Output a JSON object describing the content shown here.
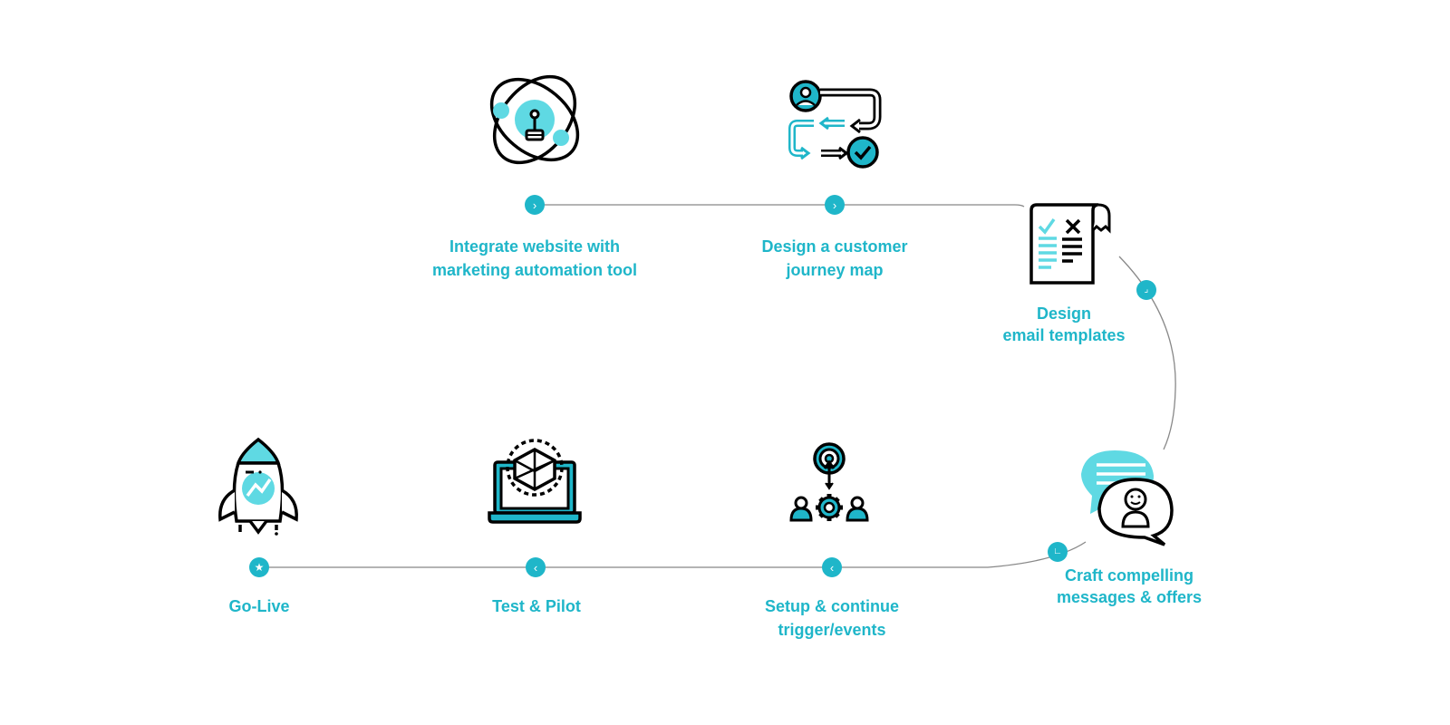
{
  "colors": {
    "accent": "#1fb6c9",
    "icon_fill": "#5fd9e3",
    "stroke": "#000000",
    "line": "#888888"
  },
  "steps": [
    {
      "id": "integrate",
      "lines": [
        "Integrate website with",
        "marketing automation tool"
      ],
      "icon": "atom-lightbulb-icon",
      "marker": "chevron-right-icon",
      "marker_glyph": "›"
    },
    {
      "id": "journey",
      "lines": [
        "Design a customer",
        "journey map"
      ],
      "icon": "customer-journey-flow-icon",
      "marker": "chevron-right-icon",
      "marker_glyph": "›"
    },
    {
      "id": "email",
      "lines": [
        "Design",
        "email templates"
      ],
      "icon": "email-template-document-icon",
      "marker": "chevron-down-icon",
      "marker_glyph": "⌟"
    },
    {
      "id": "messages",
      "lines": [
        "Craft compelling",
        "messages & offers"
      ],
      "icon": "chat-bubbles-user-icon",
      "marker": "chevron-left-down-icon",
      "marker_glyph": "∟"
    },
    {
      "id": "triggers",
      "lines": [
        "Setup & continue",
        "trigger/events"
      ],
      "icon": "target-gear-users-icon",
      "marker": "chevron-left-icon",
      "marker_glyph": "‹"
    },
    {
      "id": "test",
      "lines": [
        "Test & Pilot"
      ],
      "icon": "laptop-3d-box-icon",
      "marker": "chevron-left-icon",
      "marker_glyph": "‹"
    },
    {
      "id": "golive",
      "lines": [
        "Go-Live"
      ],
      "icon": "rocket-icon",
      "marker": "star-icon",
      "marker_glyph": "★"
    }
  ]
}
